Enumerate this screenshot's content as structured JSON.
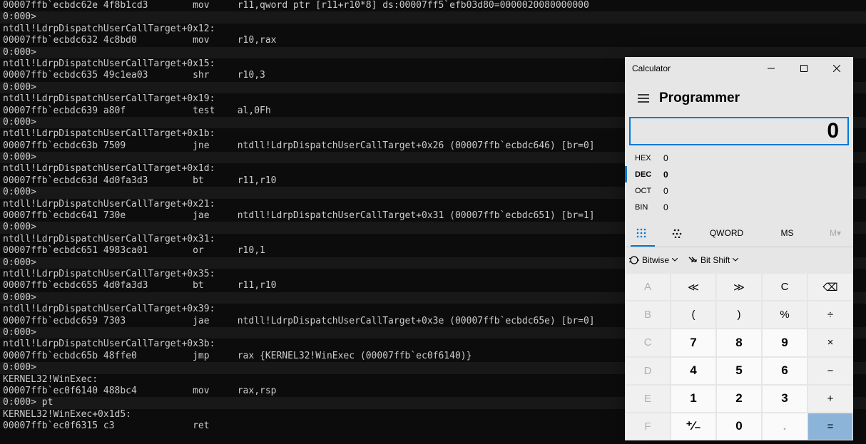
{
  "terminal": {
    "lines": [
      {
        "s": 0,
        "t": "00007ffb`ecbdc62e 4f8b1cd3        mov     r11,qword ptr [r11+r10*8] ds:00007ff5`efb03d80=0000020080000000"
      },
      {
        "s": 1,
        "t": "0:000>"
      },
      {
        "s": 0,
        "t": "ntdll!LdrpDispatchUserCallTarget+0x12:"
      },
      {
        "s": 0,
        "t": "00007ffb`ecbdc632 4c8bd0          mov     r10,rax"
      },
      {
        "s": 1,
        "t": "0:000>"
      },
      {
        "s": 0,
        "t": "ntdll!LdrpDispatchUserCallTarget+0x15:"
      },
      {
        "s": 0,
        "t": "00007ffb`ecbdc635 49c1ea03        shr     r10,3"
      },
      {
        "s": 1,
        "t": "0:000>"
      },
      {
        "s": 0,
        "t": "ntdll!LdrpDispatchUserCallTarget+0x19:"
      },
      {
        "s": 0,
        "t": "00007ffb`ecbdc639 a80f            test    al,0Fh"
      },
      {
        "s": 1,
        "t": "0:000>"
      },
      {
        "s": 0,
        "t": "ntdll!LdrpDispatchUserCallTarget+0x1b:"
      },
      {
        "s": 0,
        "t": "00007ffb`ecbdc63b 7509            jne     ntdll!LdrpDispatchUserCallTarget+0x26 (00007ffb`ecbdc646) [br=0]"
      },
      {
        "s": 1,
        "t": "0:000>"
      },
      {
        "s": 0,
        "t": "ntdll!LdrpDispatchUserCallTarget+0x1d:"
      },
      {
        "s": 0,
        "t": "00007ffb`ecbdc63d 4d0fa3d3        bt      r11,r10"
      },
      {
        "s": 1,
        "t": "0:000>"
      },
      {
        "s": 0,
        "t": "ntdll!LdrpDispatchUserCallTarget+0x21:"
      },
      {
        "s": 0,
        "t": "00007ffb`ecbdc641 730e            jae     ntdll!LdrpDispatchUserCallTarget+0x31 (00007ffb`ecbdc651) [br=1]"
      },
      {
        "s": 1,
        "t": "0:000>"
      },
      {
        "s": 0,
        "t": "ntdll!LdrpDispatchUserCallTarget+0x31:"
      },
      {
        "s": 0,
        "t": "00007ffb`ecbdc651 4983ca01        or      r10,1"
      },
      {
        "s": 1,
        "t": "0:000>"
      },
      {
        "s": 0,
        "t": "ntdll!LdrpDispatchUserCallTarget+0x35:"
      },
      {
        "s": 0,
        "t": "00007ffb`ecbdc655 4d0fa3d3        bt      r11,r10"
      },
      {
        "s": 1,
        "t": "0:000>"
      },
      {
        "s": 0,
        "t": "ntdll!LdrpDispatchUserCallTarget+0x39:"
      },
      {
        "s": 0,
        "t": "00007ffb`ecbdc659 7303            jae     ntdll!LdrpDispatchUserCallTarget+0x3e (00007ffb`ecbdc65e) [br=0]"
      },
      {
        "s": 1,
        "t": "0:000>"
      },
      {
        "s": 0,
        "t": "ntdll!LdrpDispatchUserCallTarget+0x3b:"
      },
      {
        "s": 0,
        "t": "00007ffb`ecbdc65b 48ffe0          jmp     rax {KERNEL32!WinExec (00007ffb`ec0f6140)}"
      },
      {
        "s": 1,
        "t": "0:000>"
      },
      {
        "s": 0,
        "t": "KERNEL32!WinExec:"
      },
      {
        "s": 0,
        "t": "00007ffb`ec0f6140 488bc4          mov     rax,rsp"
      },
      {
        "s": 1,
        "t": "0:000> pt"
      },
      {
        "s": 0,
        "t": "KERNEL32!WinExec+0x1d5:"
      },
      {
        "s": 0,
        "t": "00007ffb`ec0f6315 c3              ret"
      }
    ]
  },
  "calc": {
    "title": "Calculator",
    "mode": "Programmer",
    "display": "0",
    "bases": [
      {
        "lbl": "HEX",
        "val": "0",
        "active": false
      },
      {
        "lbl": "DEC",
        "val": "0",
        "active": true
      },
      {
        "lbl": "OCT",
        "val": "0",
        "active": false
      },
      {
        "lbl": "BIN",
        "val": "0",
        "active": false
      }
    ],
    "tabs": {
      "qword": "QWORD",
      "ms": "MS",
      "mt": "M▾"
    },
    "func": {
      "bitwise": "Bitwise",
      "bitshift": "Bit Shift"
    },
    "keys": {
      "A": "A",
      "lsh": "≪",
      "rsh": "≫",
      "C": "C",
      "back": "⌫",
      "B": "B",
      "lp": "(",
      "rp": ")",
      "pct": "%",
      "div": "÷",
      "Cc": "C",
      "7": "7",
      "8": "8",
      "9": "9",
      "mul": "×",
      "D": "D",
      "4": "4",
      "5": "5",
      "6": "6",
      "sub": "−",
      "E": "E",
      "1": "1",
      "2": "2",
      "3": "3",
      "add": "+",
      "F": "F",
      "pm": "⁺∕₋",
      "0": "0",
      "dot": ".",
      "eq": "="
    }
  }
}
